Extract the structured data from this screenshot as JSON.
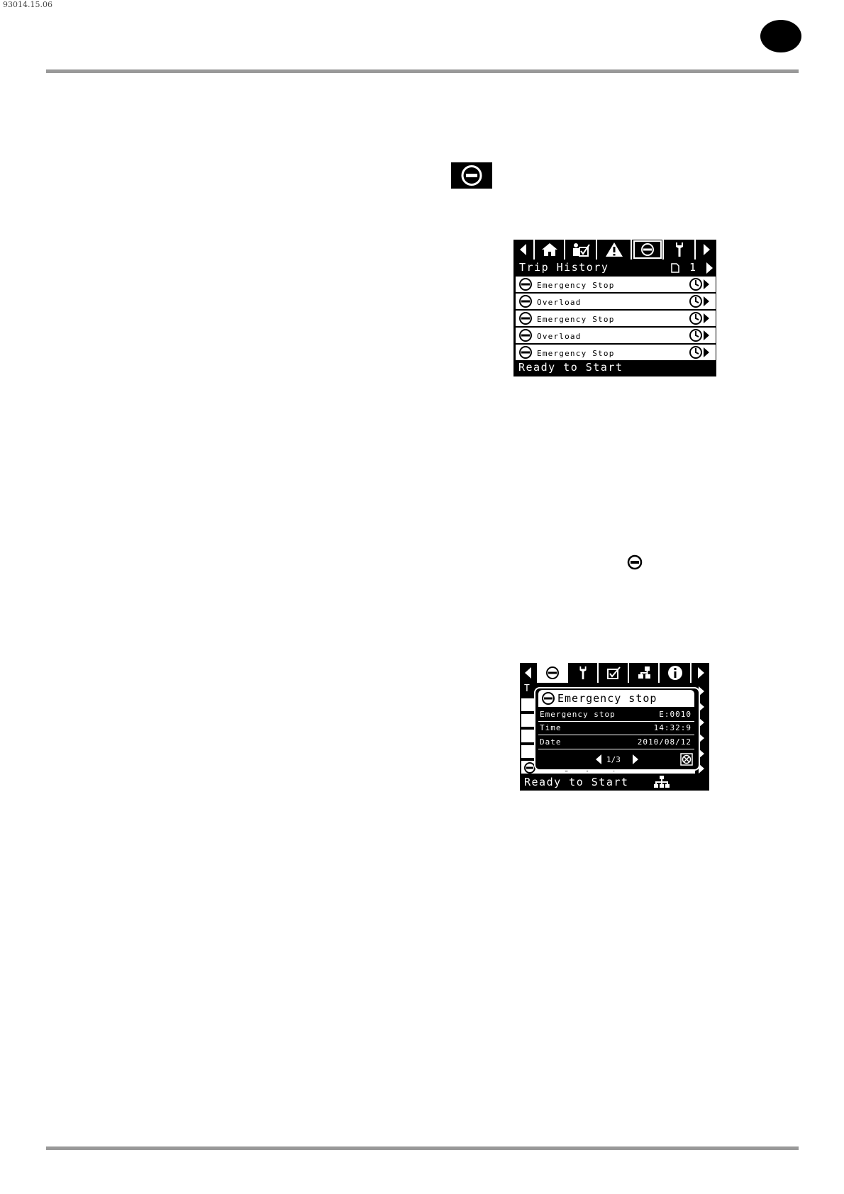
{
  "document": {
    "id": "93014.15.06"
  },
  "trip_history_screen": {
    "tabs": [
      {
        "icon": "arrow-left-icon"
      },
      {
        "icon": "home-icon"
      },
      {
        "icon": "checklist-icon"
      },
      {
        "icon": "warning-icon"
      },
      {
        "icon": "stop-icon",
        "active": true
      },
      {
        "icon": "wrench-icon"
      },
      {
        "icon": "arrow-right-icon"
      }
    ],
    "title": "Trip History",
    "page_number": "1",
    "rows": [
      {
        "label": "Emergency Stop"
      },
      {
        "label": "Overload"
      },
      {
        "label": "Emergency Stop"
      },
      {
        "label": "Overload"
      },
      {
        "label": "Emergency Stop"
      }
    ],
    "status": "Ready to Start"
  },
  "detail_screen": {
    "tabs": [
      {
        "icon": "arrow-left-icon"
      },
      {
        "icon": "stop-icon",
        "active": true
      },
      {
        "icon": "wrench-icon"
      },
      {
        "icon": "checklist-icon"
      },
      {
        "icon": "network-icon"
      },
      {
        "icon": "info-icon"
      },
      {
        "icon": "arrow-right-icon"
      }
    ],
    "bg_title_initial": "T",
    "popup": {
      "title": "Emergency stop",
      "rows": [
        {
          "key": "Emergency stop",
          "value": "E:0010"
        },
        {
          "key": "Time",
          "value": "14:32:9"
        },
        {
          "key": "Date",
          "value": "2010/08/12"
        }
      ],
      "pager": "1/3"
    },
    "bg_last_row": "Emergency stop",
    "status": "Ready to Start"
  }
}
